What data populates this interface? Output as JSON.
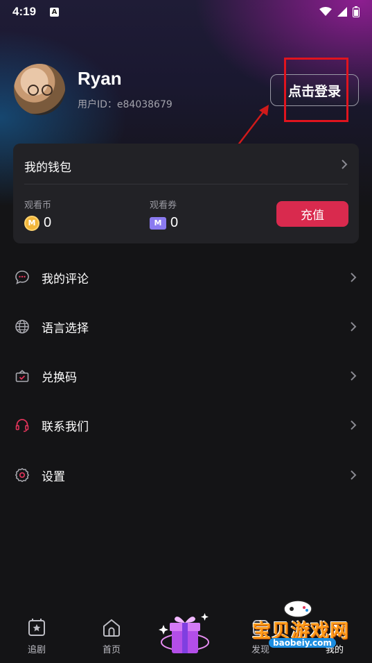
{
  "status_bar": {
    "time": "4:19",
    "notif_badge": "A"
  },
  "profile": {
    "name": "Ryan",
    "user_id": "用户ID：e84038679",
    "login_label": "点击登录"
  },
  "wallet": {
    "title": "我的钱包",
    "coins_label": "观看币",
    "coins_value": "0",
    "coins_icon_glyph": "M",
    "tickets_label": "观看券",
    "tickets_value": "0",
    "tickets_icon_glyph": "M",
    "recharge_label": "充值"
  },
  "menu": [
    {
      "label": "我的评论",
      "icon": "comment-icon"
    },
    {
      "label": "语言选择",
      "icon": "globe-icon"
    },
    {
      "label": "兑换码",
      "icon": "gift-box-icon"
    },
    {
      "label": "联系我们",
      "icon": "headset-icon"
    },
    {
      "label": "设置",
      "icon": "gear-icon"
    }
  ],
  "bottom_nav": {
    "items": [
      {
        "label": "追剧",
        "icon": "bookmark-star-icon"
      },
      {
        "label": "首页",
        "icon": "home-icon"
      },
      {
        "label": "发现",
        "icon": "discover-icon"
      },
      {
        "label": "我的",
        "icon": "profile-icon"
      }
    ]
  },
  "watermark": {
    "text": "宝贝游戏网",
    "sub": "baobeiy.com"
  },
  "colors": {
    "accent": "#d92a4e",
    "highlight": "#e0141e",
    "card": "#222226",
    "background": "#141416"
  }
}
